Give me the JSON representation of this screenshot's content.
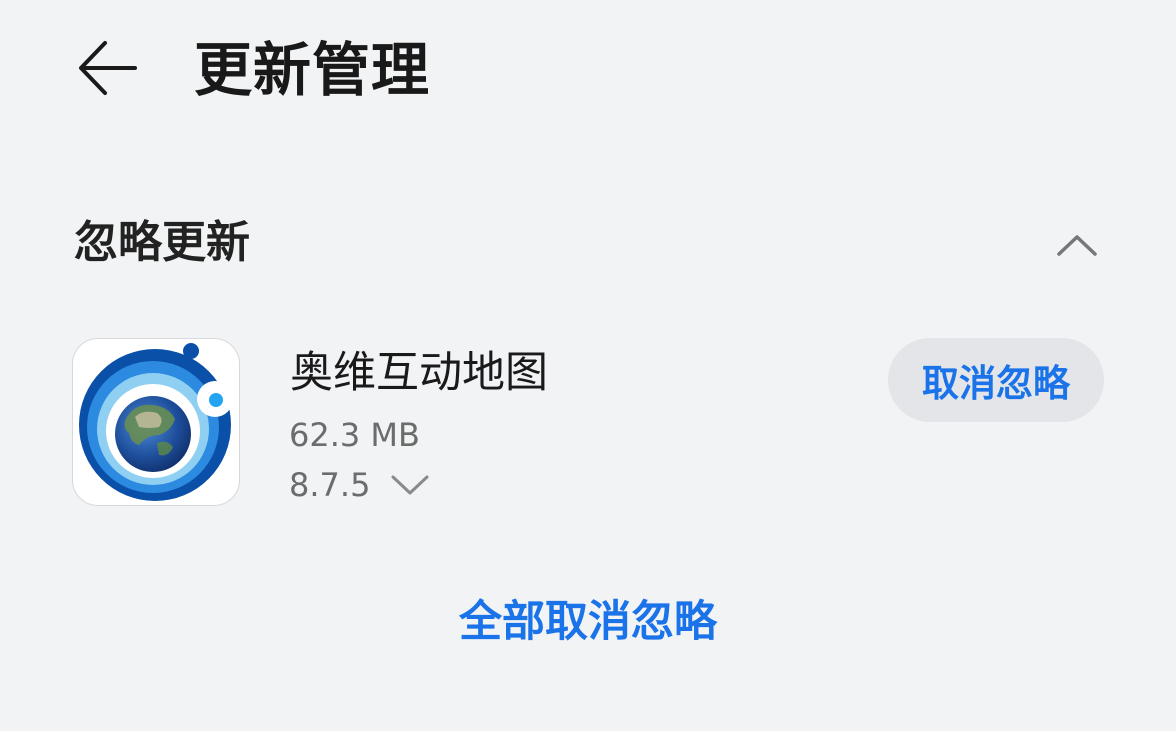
{
  "header": {
    "title": "更新管理",
    "back_icon": "arrow-left-icon"
  },
  "section": {
    "title": "忽略更新",
    "toggle_icon": "chevron-up-icon",
    "expanded": true
  },
  "apps": [
    {
      "name": "奥维互动地图",
      "size": "62.3 MB",
      "version": "8.7.5",
      "action_label": "取消忽略",
      "icon": "globe-app-icon",
      "version_icon": "chevron-down-icon"
    }
  ],
  "footer": {
    "unignore_all_label": "全部取消忽略"
  },
  "colors": {
    "background": "#f1f3f5",
    "accent": "#1a73e8",
    "button_bg": "#e3e5e8",
    "secondary_text": "#6c6c6c"
  }
}
